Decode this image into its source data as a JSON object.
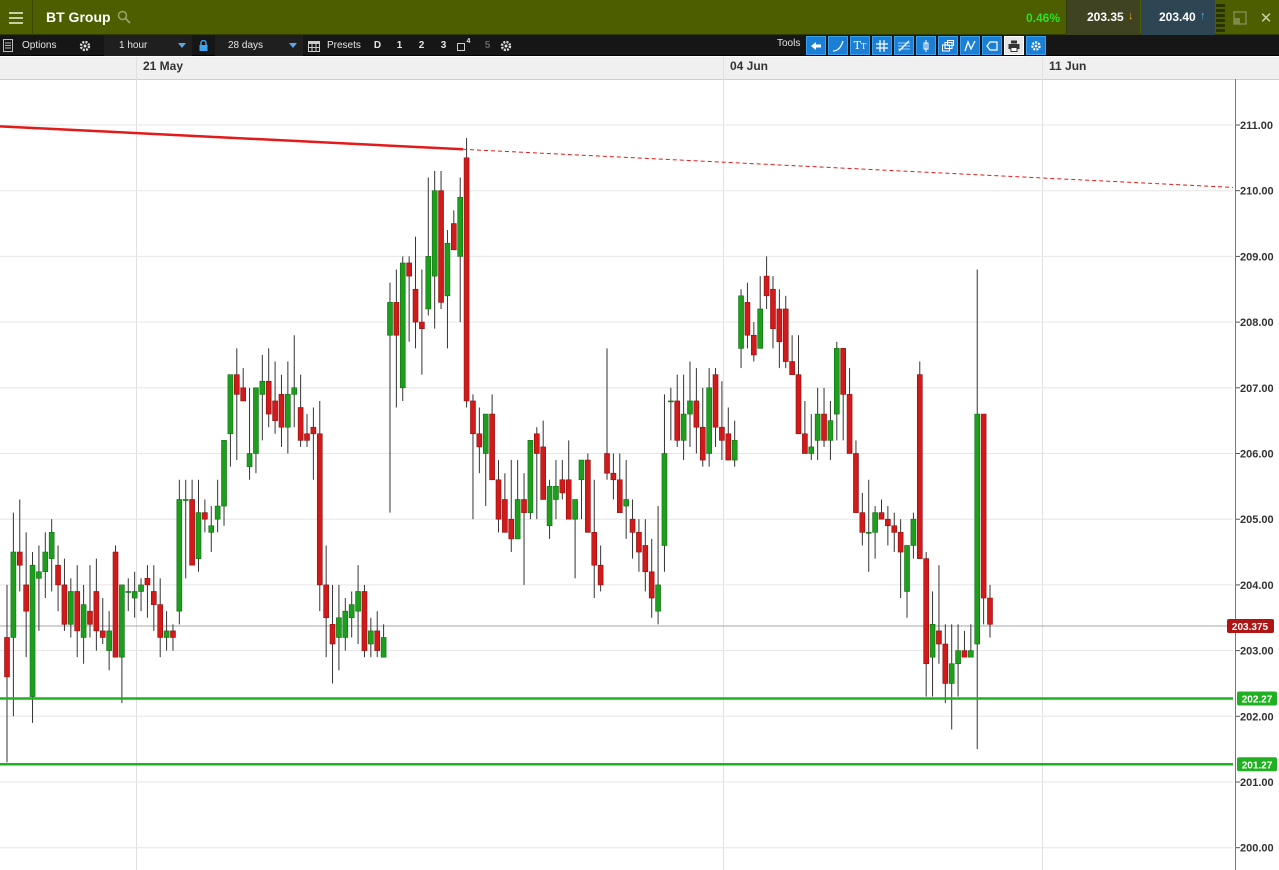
{
  "header": {
    "title": "BT Group",
    "change": "0.46%",
    "sell_price": "203.35",
    "buy_price": "203.40"
  },
  "toolbar": {
    "options_label": "Options",
    "interval_label": "1 hour",
    "range_label": "28 days",
    "presets_label": "Presets",
    "presets": [
      "D",
      "1",
      "2",
      "3",
      "4",
      "5"
    ],
    "tools_label": "Tools"
  },
  "colors": {
    "header_bg": "#4c5e00",
    "up_candle": "#1e9e1e",
    "down_candle": "#d31a1a",
    "resistance_line": "#e41a1a",
    "support_line": "#21b021",
    "current_price_tag": "#b01515"
  },
  "chart_data": {
    "type": "candlestick",
    "x_labels": [
      "21 May",
      "04 Jun",
      "11 Jun"
    ],
    "y_ticks": [
      "211.00",
      "210.00",
      "209.00",
      "208.00",
      "207.00",
      "206.00",
      "205.00",
      "204.00",
      "203.00",
      "202.00",
      "201.00",
      "200.00"
    ],
    "ylim": [
      199.8,
      212.0
    ],
    "current_price": "203.375",
    "levels": [
      {
        "label": "202.27",
        "value": 202.27
      },
      {
        "label": "201.27",
        "value": 201.27
      }
    ],
    "trendline": {
      "from": 210.98,
      "to_touch": 210.63,
      "extended_to": 210.05
    },
    "candles": [
      [
        203.2,
        204.0,
        201.3,
        202.6
      ],
      [
        203.2,
        205.1,
        202.0,
        204.5
      ],
      [
        204.5,
        205.3,
        203.9,
        204.3
      ],
      [
        204.0,
        204.8,
        202.9,
        203.6
      ],
      [
        202.3,
        204.5,
        201.9,
        204.3
      ],
      [
        204.1,
        204.6,
        203.3,
        204.2
      ],
      [
        204.2,
        204.8,
        203.8,
        204.5
      ],
      [
        204.4,
        205.0,
        203.9,
        204.8
      ],
      [
        204.3,
        204.6,
        203.6,
        204.0
      ],
      [
        204.0,
        204.4,
        203.3,
        203.4
      ],
      [
        203.4,
        204.1,
        203.2,
        203.9
      ],
      [
        203.9,
        204.3,
        202.9,
        203.3
      ],
      [
        203.2,
        204.0,
        202.8,
        203.7
      ],
      [
        203.6,
        204.3,
        203.2,
        203.4
      ],
      [
        203.9,
        204.4,
        203.0,
        203.3
      ],
      [
        203.3,
        203.8,
        203.1,
        203.2
      ],
      [
        203.0,
        203.6,
        202.7,
        203.3
      ],
      [
        204.5,
        204.6,
        202.9,
        202.9
      ],
      [
        202.9,
        204.0,
        202.2,
        204.0
      ],
      [
        203.9,
        204.1,
        203.6,
        203.9
      ],
      [
        203.8,
        204.2,
        203.5,
        203.9
      ],
      [
        203.9,
        204.1,
        203.6,
        204.0
      ],
      [
        204.1,
        204.3,
        203.5,
        204.0
      ],
      [
        203.9,
        204.3,
        203.3,
        203.7
      ],
      [
        203.7,
        204.1,
        202.9,
        203.2
      ],
      [
        203.2,
        203.6,
        203.0,
        203.3
      ],
      [
        203.3,
        203.4,
        203.0,
        203.2
      ],
      [
        203.6,
        205.6,
        203.4,
        205.3
      ],
      [
        205.3,
        205.6,
        204.1,
        205.3
      ],
      [
        205.3,
        205.6,
        204.6,
        204.3
      ],
      [
        204.4,
        205.6,
        204.2,
        205.1
      ],
      [
        205.1,
        205.3,
        204.8,
        205.0
      ],
      [
        204.8,
        205.2,
        204.5,
        204.9
      ],
      [
        205.0,
        205.6,
        204.8,
        205.2
      ],
      [
        205.2,
        206.2,
        204.9,
        206.2
      ],
      [
        206.3,
        207.2,
        205.8,
        207.2
      ],
      [
        207.2,
        207.6,
        205.9,
        206.9
      ],
      [
        207.0,
        207.3,
        206.8,
        206.8
      ],
      [
        205.8,
        207.0,
        205.6,
        206.0
      ],
      [
        206.0,
        206.8,
        205.7,
        207.0
      ],
      [
        206.9,
        207.5,
        206.2,
        207.1
      ],
      [
        207.1,
        207.6,
        206.4,
        206.6
      ],
      [
        206.8,
        207.4,
        206.3,
        206.5
      ],
      [
        206.9,
        207.2,
        206.1,
        206.4
      ],
      [
        206.4,
        207.4,
        206.0,
        206.9
      ],
      [
        206.9,
        207.8,
        206.4,
        207.0
      ],
      [
        206.7,
        207.2,
        206.1,
        206.2
      ],
      [
        206.3,
        206.6,
        206.1,
        206.2
      ],
      [
        206.4,
        206.7,
        205.6,
        206.3
      ],
      [
        206.3,
        206.8,
        203.6,
        204.0
      ],
      [
        204.0,
        204.6,
        202.9,
        203.5
      ],
      [
        203.4,
        204.0,
        202.5,
        203.1
      ],
      [
        203.2,
        204.0,
        202.7,
        203.5
      ],
      [
        203.2,
        203.8,
        203.0,
        203.6
      ],
      [
        203.5,
        203.9,
        203.2,
        203.7
      ],
      [
        203.6,
        204.3,
        203.1,
        203.9
      ],
      [
        203.9,
        204.0,
        202.9,
        203.0
      ],
      [
        203.1,
        203.5,
        202.9,
        203.3
      ],
      [
        203.3,
        203.6,
        202.9,
        203.0
      ],
      [
        202.9,
        203.4,
        202.9,
        203.2
      ],
      [
        207.8,
        208.6,
        205.1,
        208.3
      ],
      [
        208.3,
        208.8,
        206.7,
        207.8
      ],
      [
        207.0,
        209.0,
        206.8,
        208.9
      ],
      [
        208.9,
        209.0,
        207.7,
        208.7
      ],
      [
        208.5,
        209.3,
        207.6,
        208.0
      ],
      [
        208.0,
        208.8,
        207.2,
        207.9
      ],
      [
        208.2,
        210.2,
        208.1,
        209.0
      ],
      [
        208.7,
        210.3,
        207.9,
        210.0
      ],
      [
        210.0,
        210.3,
        208.2,
        208.3
      ],
      [
        208.4,
        209.4,
        207.6,
        209.2
      ],
      [
        209.5,
        209.7,
        209.1,
        209.1
      ],
      [
        209.0,
        210.2,
        208.0,
        209.9
      ],
      [
        210.5,
        210.8,
        206.7,
        206.8
      ],
      [
        206.8,
        206.9,
        205.0,
        206.3
      ],
      [
        206.3,
        206.7,
        205.7,
        206.1
      ],
      [
        206.0,
        206.4,
        205.2,
        206.6
      ],
      [
        206.6,
        206.9,
        205.6,
        205.6
      ],
      [
        205.6,
        205.9,
        204.8,
        205.0
      ],
      [
        205.3,
        205.7,
        204.8,
        204.8
      ],
      [
        205.0,
        205.9,
        204.5,
        204.7
      ],
      [
        204.7,
        205.9,
        204.8,
        205.3
      ],
      [
        205.3,
        205.7,
        204.0,
        205.1
      ],
      [
        205.1,
        205.9,
        205.0,
        206.2
      ],
      [
        206.3,
        206.4,
        205.0,
        206.0
      ],
      [
        206.1,
        206.5,
        205.6,
        205.3
      ],
      [
        204.9,
        205.6,
        204.7,
        205.5
      ],
      [
        205.3,
        205.9,
        205.0,
        205.5
      ],
      [
        205.6,
        205.9,
        205.3,
        205.4
      ],
      [
        205.6,
        206.2,
        205.1,
        205.0
      ],
      [
        205.0,
        205.3,
        204.1,
        205.3
      ],
      [
        205.6,
        205.8,
        205.0,
        205.9
      ],
      [
        205.9,
        206.0,
        205.4,
        204.8
      ],
      [
        204.8,
        205.6,
        203.8,
        204.3
      ],
      [
        204.3,
        204.6,
        203.9,
        204.0
      ],
      [
        206.0,
        207.6,
        205.6,
        205.7
      ],
      [
        205.7,
        206.0,
        205.3,
        205.6
      ],
      [
        205.6,
        206.0,
        205.2,
        205.1
      ],
      [
        205.2,
        205.9,
        204.7,
        205.3
      ],
      [
        205.0,
        205.3,
        204.4,
        204.8
      ],
      [
        204.8,
        205.0,
        204.2,
        204.5
      ],
      [
        204.6,
        205.0,
        203.9,
        204.2
      ],
      [
        204.2,
        204.7,
        203.5,
        203.8
      ],
      [
        203.6,
        205.2,
        203.4,
        204.0
      ],
      [
        204.6,
        206.9,
        204.2,
        206.0
      ],
      [
        206.8,
        207.0,
        206.2,
        206.8
      ],
      [
        206.8,
        207.2,
        206.1,
        206.2
      ],
      [
        206.2,
        207.2,
        205.9,
        206.6
      ],
      [
        206.6,
        207.4,
        206.1,
        206.8
      ],
      [
        206.8,
        207.3,
        206.0,
        206.4
      ],
      [
        206.4,
        207.0,
        205.8,
        205.9
      ],
      [
        206.0,
        207.3,
        205.8,
        207.0
      ],
      [
        207.2,
        207.3,
        206.1,
        206.4
      ],
      [
        206.4,
        207.1,
        205.9,
        206.2
      ],
      [
        206.3,
        206.7,
        205.9,
        205.9
      ],
      [
        205.9,
        206.5,
        205.8,
        206.2
      ],
      [
        207.6,
        208.5,
        207.3,
        208.4
      ],
      [
        208.3,
        208.6,
        207.6,
        207.8
      ],
      [
        207.8,
        208.0,
        207.4,
        207.5
      ],
      [
        207.6,
        208.7,
        207.8,
        208.2
      ],
      [
        208.7,
        209.0,
        208.2,
        208.4
      ],
      [
        208.5,
        208.7,
        207.6,
        207.9
      ],
      [
        208.2,
        208.5,
        207.3,
        207.7
      ],
      [
        208.2,
        208.4,
        207.3,
        207.4
      ],
      [
        207.4,
        207.8,
        207.2,
        207.2
      ],
      [
        207.2,
        207.8,
        206.4,
        206.3
      ],
      [
        206.3,
        206.8,
        206.0,
        206.0
      ],
      [
        206.0,
        206.6,
        205.9,
        206.1
      ],
      [
        206.2,
        207.0,
        205.9,
        206.6
      ],
      [
        206.6,
        207.0,
        206.1,
        206.2
      ],
      [
        206.2,
        206.8,
        205.9,
        206.5
      ],
      [
        206.6,
        207.7,
        206.2,
        207.6
      ],
      [
        207.6,
        207.5,
        206.2,
        206.9
      ],
      [
        206.9,
        207.3,
        206.1,
        206.0
      ],
      [
        206.0,
        206.2,
        205.8,
        205.1
      ],
      [
        205.1,
        205.4,
        204.6,
        204.8
      ],
      [
        204.8,
        205.6,
        204.2,
        204.8
      ],
      [
        204.8,
        205.2,
        204.4,
        205.1
      ],
      [
        205.1,
        205.3,
        205.0,
        205.0
      ],
      [
        205.0,
        205.2,
        204.6,
        204.9
      ],
      [
        204.9,
        205.1,
        204.5,
        204.8
      ],
      [
        204.8,
        205.0,
        203.8,
        204.5
      ],
      [
        203.9,
        204.6,
        203.5,
        204.6
      ],
      [
        204.6,
        205.1,
        204.4,
        205.0
      ],
      [
        207.2,
        207.4,
        204.6,
        204.4
      ],
      [
        204.4,
        204.5,
        202.3,
        202.8
      ],
      [
        202.9,
        203.9,
        202.3,
        203.4
      ],
      [
        203.3,
        204.3,
        202.8,
        203.1
      ],
      [
        203.1,
        203.4,
        202.2,
        202.5
      ],
      [
        202.5,
        203.4,
        201.8,
        202.8
      ],
      [
        202.8,
        203.4,
        202.3,
        203.0
      ],
      [
        203.0,
        203.3,
        202.9,
        202.9
      ],
      [
        202.9,
        203.4,
        202.9,
        203.0
      ],
      [
        203.1,
        208.8,
        201.5,
        206.6
      ],
      [
        206.6,
        205.2,
        203.4,
        203.8
      ],
      [
        203.8,
        204.0,
        203.2,
        203.4
      ]
    ]
  }
}
